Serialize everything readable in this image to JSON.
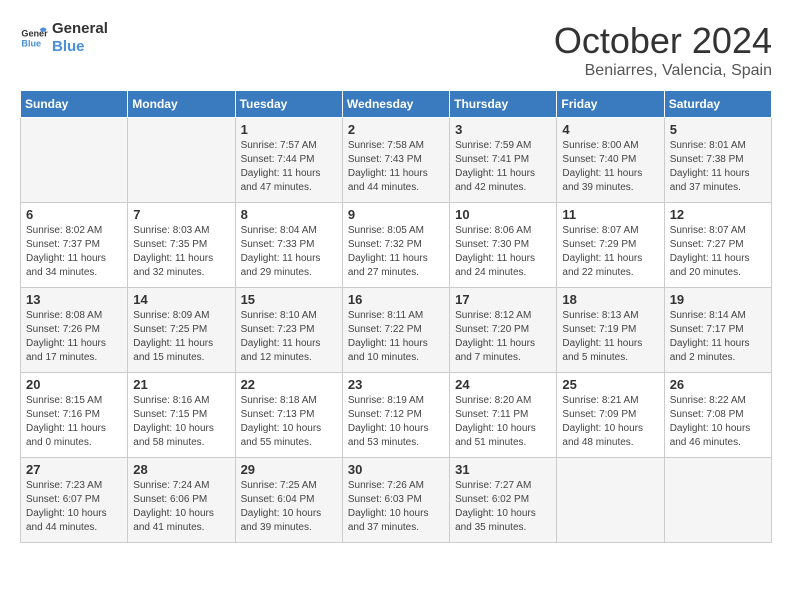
{
  "header": {
    "logo_line1": "General",
    "logo_line2": "Blue",
    "month": "October 2024",
    "location": "Beniarres, Valencia, Spain"
  },
  "days_of_week": [
    "Sunday",
    "Monday",
    "Tuesday",
    "Wednesday",
    "Thursday",
    "Friday",
    "Saturday"
  ],
  "weeks": [
    [
      {
        "day": "",
        "info": ""
      },
      {
        "day": "",
        "info": ""
      },
      {
        "day": "1",
        "info": "Sunrise: 7:57 AM\nSunset: 7:44 PM\nDaylight: 11 hours and 47 minutes."
      },
      {
        "day": "2",
        "info": "Sunrise: 7:58 AM\nSunset: 7:43 PM\nDaylight: 11 hours and 44 minutes."
      },
      {
        "day": "3",
        "info": "Sunrise: 7:59 AM\nSunset: 7:41 PM\nDaylight: 11 hours and 42 minutes."
      },
      {
        "day": "4",
        "info": "Sunrise: 8:00 AM\nSunset: 7:40 PM\nDaylight: 11 hours and 39 minutes."
      },
      {
        "day": "5",
        "info": "Sunrise: 8:01 AM\nSunset: 7:38 PM\nDaylight: 11 hours and 37 minutes."
      }
    ],
    [
      {
        "day": "6",
        "info": "Sunrise: 8:02 AM\nSunset: 7:37 PM\nDaylight: 11 hours and 34 minutes."
      },
      {
        "day": "7",
        "info": "Sunrise: 8:03 AM\nSunset: 7:35 PM\nDaylight: 11 hours and 32 minutes."
      },
      {
        "day": "8",
        "info": "Sunrise: 8:04 AM\nSunset: 7:33 PM\nDaylight: 11 hours and 29 minutes."
      },
      {
        "day": "9",
        "info": "Sunrise: 8:05 AM\nSunset: 7:32 PM\nDaylight: 11 hours and 27 minutes."
      },
      {
        "day": "10",
        "info": "Sunrise: 8:06 AM\nSunset: 7:30 PM\nDaylight: 11 hours and 24 minutes."
      },
      {
        "day": "11",
        "info": "Sunrise: 8:07 AM\nSunset: 7:29 PM\nDaylight: 11 hours and 22 minutes."
      },
      {
        "day": "12",
        "info": "Sunrise: 8:07 AM\nSunset: 7:27 PM\nDaylight: 11 hours and 20 minutes."
      }
    ],
    [
      {
        "day": "13",
        "info": "Sunrise: 8:08 AM\nSunset: 7:26 PM\nDaylight: 11 hours and 17 minutes."
      },
      {
        "day": "14",
        "info": "Sunrise: 8:09 AM\nSunset: 7:25 PM\nDaylight: 11 hours and 15 minutes."
      },
      {
        "day": "15",
        "info": "Sunrise: 8:10 AM\nSunset: 7:23 PM\nDaylight: 11 hours and 12 minutes."
      },
      {
        "day": "16",
        "info": "Sunrise: 8:11 AM\nSunset: 7:22 PM\nDaylight: 11 hours and 10 minutes."
      },
      {
        "day": "17",
        "info": "Sunrise: 8:12 AM\nSunset: 7:20 PM\nDaylight: 11 hours and 7 minutes."
      },
      {
        "day": "18",
        "info": "Sunrise: 8:13 AM\nSunset: 7:19 PM\nDaylight: 11 hours and 5 minutes."
      },
      {
        "day": "19",
        "info": "Sunrise: 8:14 AM\nSunset: 7:17 PM\nDaylight: 11 hours and 2 minutes."
      }
    ],
    [
      {
        "day": "20",
        "info": "Sunrise: 8:15 AM\nSunset: 7:16 PM\nDaylight: 11 hours and 0 minutes."
      },
      {
        "day": "21",
        "info": "Sunrise: 8:16 AM\nSunset: 7:15 PM\nDaylight: 10 hours and 58 minutes."
      },
      {
        "day": "22",
        "info": "Sunrise: 8:18 AM\nSunset: 7:13 PM\nDaylight: 10 hours and 55 minutes."
      },
      {
        "day": "23",
        "info": "Sunrise: 8:19 AM\nSunset: 7:12 PM\nDaylight: 10 hours and 53 minutes."
      },
      {
        "day": "24",
        "info": "Sunrise: 8:20 AM\nSunset: 7:11 PM\nDaylight: 10 hours and 51 minutes."
      },
      {
        "day": "25",
        "info": "Sunrise: 8:21 AM\nSunset: 7:09 PM\nDaylight: 10 hours and 48 minutes."
      },
      {
        "day": "26",
        "info": "Sunrise: 8:22 AM\nSunset: 7:08 PM\nDaylight: 10 hours and 46 minutes."
      }
    ],
    [
      {
        "day": "27",
        "info": "Sunrise: 7:23 AM\nSunset: 6:07 PM\nDaylight: 10 hours and 44 minutes."
      },
      {
        "day": "28",
        "info": "Sunrise: 7:24 AM\nSunset: 6:06 PM\nDaylight: 10 hours and 41 minutes."
      },
      {
        "day": "29",
        "info": "Sunrise: 7:25 AM\nSunset: 6:04 PM\nDaylight: 10 hours and 39 minutes."
      },
      {
        "day": "30",
        "info": "Sunrise: 7:26 AM\nSunset: 6:03 PM\nDaylight: 10 hours and 37 minutes."
      },
      {
        "day": "31",
        "info": "Sunrise: 7:27 AM\nSunset: 6:02 PM\nDaylight: 10 hours and 35 minutes."
      },
      {
        "day": "",
        "info": ""
      },
      {
        "day": "",
        "info": ""
      }
    ]
  ]
}
